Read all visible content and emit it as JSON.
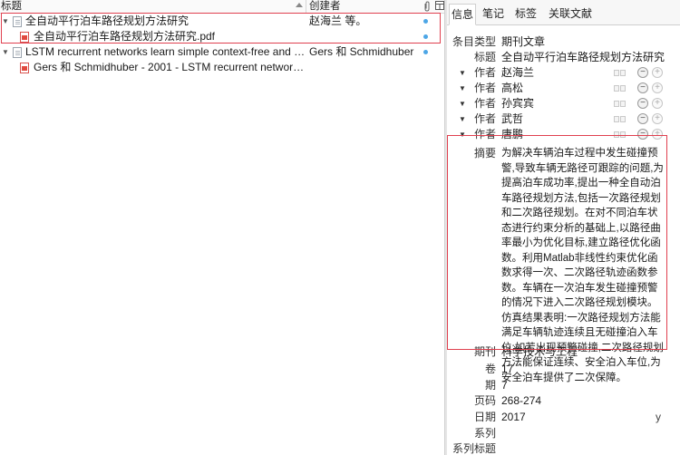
{
  "columns": {
    "title": "标题",
    "creator": "创建者",
    "attachments_icon": "paperclip-icon",
    "picker_icon": "column-picker-icon"
  },
  "items": [
    {
      "title": "全自动平行泊车路径规划方法研究",
      "creator": "赵海兰 等。",
      "type": "journal-article",
      "expanded": true
    },
    {
      "title": "全自动平行泊车路径规划方法研究.pdf",
      "creator": "",
      "type": "pdf-attachment"
    },
    {
      "title": "LSTM recurrent networks learn simple context-free and con...",
      "creator": "Gers 和 Schmidhuber",
      "type": "journal-article",
      "expanded": true
    },
    {
      "title": "Gers 和 Schmidhuber - 2001 - LSTM recurrent networks l...",
      "creator": "",
      "type": "pdf-attachment"
    }
  ],
  "tabs": [
    "信息",
    "笔记",
    "标签",
    "关联文献"
  ],
  "info": {
    "item_type_label": "条目类型",
    "item_type": "期刊文章",
    "title_label": "标题",
    "title": "全自动平行泊车路径规划方法研究",
    "author_label": "作者",
    "authors": [
      "赵海兰",
      "高松",
      "孙宾宾",
      "武哲",
      "唐鹏"
    ],
    "abstract_label": "摘要",
    "abstract": "为解决车辆泊车过程中发生碰撞预警,导致车辆无路径可跟踪的问题,为提高泊车成功率,提出一种全自动泊车路径规划方法,包括一次路径规划和二次路径规划。在对不同泊车状态进行约束分析的基础上,以路径曲率最小为优化目标,建立路径优化函数。利用Matlab非线性约束优化函数求得一次、二次路径轨迹函数参数。车辆在一次泊车发生碰撞预警的情况下进入二次路径规划模块。仿真结果表明:一次路径规划方法能满足车辆轨迹连续且无碰撞泊入车位;如若出现预警碰撞,二次路径规划方法能保证连续、安全泊入车位,为安全泊车提供了二次保障。",
    "fields": [
      {
        "label": "期刊",
        "value": "科学技术与工程"
      },
      {
        "label": "卷",
        "value": "17"
      },
      {
        "label": "期",
        "value": "7"
      },
      {
        "label": "页码",
        "value": "268-274"
      },
      {
        "label": "日期",
        "value": "2017"
      },
      {
        "label": "系列",
        "value": ""
      },
      {
        "label": "系列标题",
        "value": ""
      }
    ],
    "date_suffix": "y"
  }
}
